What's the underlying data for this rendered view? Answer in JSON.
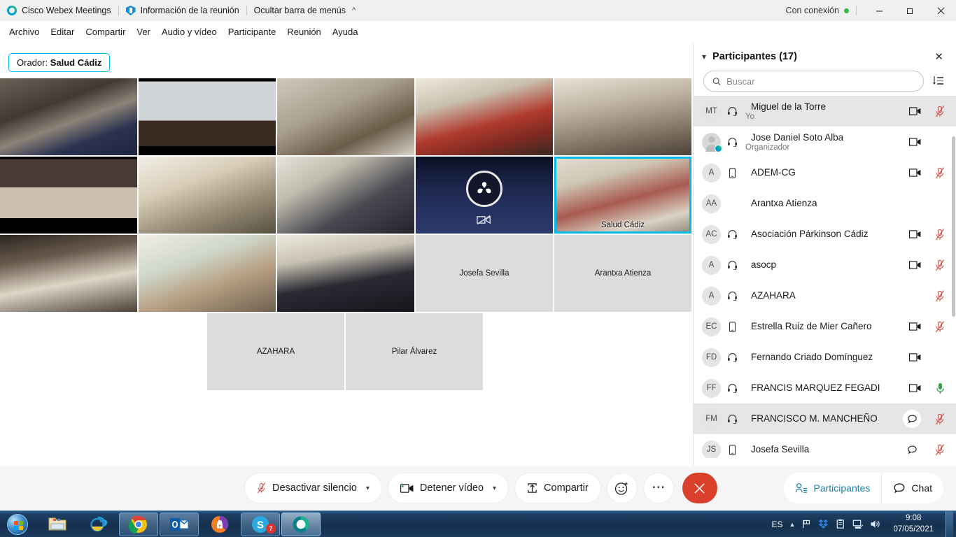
{
  "titlebar": {
    "app_name": "Cisco Webex Meetings",
    "meeting_info": "Información de la reunión",
    "hide_menubar": "Ocultar barra de menús",
    "connection_status": "Con conexión",
    "minimize": "—",
    "maximize": "❐",
    "close": "✕"
  },
  "menubar": {
    "items": [
      {
        "label": "Archivo"
      },
      {
        "label": "Editar"
      },
      {
        "label": "Compartir"
      },
      {
        "label": "Ver"
      },
      {
        "label": "Audio y vídeo"
      },
      {
        "label": "Participante"
      },
      {
        "label": "Reunión"
      },
      {
        "label": "Ayuda"
      }
    ]
  },
  "stage": {
    "speaker_prefix": "Orador:",
    "speaker_name": "Salud Cádiz",
    "tiles": [
      {
        "name": "",
        "kind": "video",
        "photo": "ph1"
      },
      {
        "name": "",
        "kind": "video",
        "photo": "ph2"
      },
      {
        "name": "",
        "kind": "video",
        "photo": "ph3"
      },
      {
        "name": "",
        "kind": "video",
        "photo": "ph4"
      },
      {
        "name": "",
        "kind": "video",
        "photo": "ph5"
      },
      {
        "name": "",
        "kind": "video",
        "photo": "ph6"
      },
      {
        "name": "",
        "kind": "video",
        "photo": "ph7"
      },
      {
        "name": "",
        "kind": "video",
        "photo": "ph8"
      },
      {
        "name": "",
        "kind": "novideo",
        "photo": "ph9"
      },
      {
        "name": "Salud Cádiz",
        "kind": "video-active",
        "photo": "ph10"
      },
      {
        "name": "",
        "kind": "video",
        "photo": "ph11"
      },
      {
        "name": "",
        "kind": "video",
        "photo": "ph12"
      },
      {
        "name": "",
        "kind": "video",
        "photo": "ph13"
      },
      {
        "name": "Josefa Sevilla",
        "kind": "placeholder",
        "photo": ""
      },
      {
        "name": "Arantxa Atienza",
        "kind": "placeholder",
        "photo": ""
      },
      {
        "name": "AZAHARA",
        "kind": "placeholder",
        "photo": ""
      },
      {
        "name": "Pilar Álvarez",
        "kind": "placeholder",
        "photo": ""
      }
    ]
  },
  "panel": {
    "title": "Participantes (17)",
    "collapse_icon": "chevron-down-icon",
    "close_icon": "close-icon",
    "search_placeholder": "Buscar",
    "search_value": "",
    "sort_icon": "sort-icon",
    "participants": [
      {
        "initials": "MT",
        "name": "Miguel de la Torre",
        "sub": "Yo",
        "device": "headset",
        "video": true,
        "mic": "muted",
        "chat": false,
        "selected": true,
        "host": false
      },
      {
        "initials": "",
        "name": "Jose Daniel Soto Alba",
        "sub": "Organizador",
        "device": "headset",
        "video": true,
        "mic": "none",
        "chat": false,
        "selected": false,
        "host": true
      },
      {
        "initials": "A",
        "name": "ADEM-CG",
        "sub": "",
        "device": "mobile",
        "video": true,
        "mic": "muted",
        "chat": false,
        "selected": false,
        "host": false
      },
      {
        "initials": "AA",
        "name": "Arantxa Atienza",
        "sub": "",
        "device": "none",
        "video": false,
        "mic": "none",
        "chat": false,
        "selected": false,
        "host": false
      },
      {
        "initials": "AC",
        "name": "Asociación Párkinson Cádiz",
        "sub": "",
        "device": "headset",
        "video": true,
        "mic": "muted",
        "chat": false,
        "selected": false,
        "host": false
      },
      {
        "initials": "A",
        "name": "asocp",
        "sub": "",
        "device": "headset",
        "video": true,
        "mic": "muted",
        "chat": false,
        "selected": false,
        "host": false
      },
      {
        "initials": "A",
        "name": "AZAHARA",
        "sub": "",
        "device": "headset",
        "video": false,
        "mic": "muted",
        "chat": false,
        "selected": false,
        "host": false
      },
      {
        "initials": "EC",
        "name": "Estrella Ruiz de Mier Cañero",
        "sub": "",
        "device": "mobile",
        "video": true,
        "mic": "muted",
        "chat": false,
        "selected": false,
        "host": false
      },
      {
        "initials": "FD",
        "name": "Fernando Criado Domínguez",
        "sub": "",
        "device": "headset",
        "video": true,
        "mic": "none",
        "chat": false,
        "selected": false,
        "host": false
      },
      {
        "initials": "FF",
        "name": "FRANCIS MARQUEZ FEGADI",
        "sub": "",
        "device": "headset",
        "video": true,
        "mic": "active",
        "chat": false,
        "selected": false,
        "host": false
      },
      {
        "initials": "FM",
        "name": "FRANCISCO M. MANCHEÑO",
        "sub": "",
        "device": "headset",
        "video": false,
        "mic": "muted",
        "chat": true,
        "selected": true,
        "host": false
      },
      {
        "initials": "JS",
        "name": "Josefa Sevilla",
        "sub": "",
        "device": "mobile",
        "video": false,
        "mic": "muted",
        "chat": true,
        "selected": false,
        "host": false
      }
    ]
  },
  "toolbar": {
    "unmute_label": "Desactivar silencio",
    "stop_video_label": "Detener vídeo",
    "share_label": "Compartir",
    "reactions_icon": "smiley-icon",
    "more_icon": "ellipsis-icon",
    "end_icon": "close-icon",
    "participants_label": "Participantes",
    "chat_label": "Chat"
  },
  "taskbar": {
    "apps": [
      {
        "name": "windows-explorer"
      },
      {
        "name": "internet-explorer"
      },
      {
        "name": "google-chrome"
      },
      {
        "name": "microsoft-outlook"
      },
      {
        "name": "avast-antivirus"
      },
      {
        "name": "skype",
        "badge": "7"
      },
      {
        "name": "cisco-webex"
      }
    ],
    "language": "ES",
    "time": "9:08",
    "date": "07/05/2021"
  },
  "colors": {
    "accent_cyan": "#00bceb",
    "end_red": "#d8402c",
    "mute_red": "#d9534f",
    "mic_green": "#28a745",
    "link_blue": "#1d7fa8",
    "online_green": "#39b54a"
  }
}
